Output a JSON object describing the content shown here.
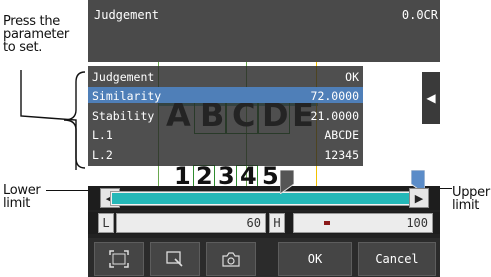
{
  "annotations": {
    "press_line1": "Press the",
    "press_line2": "parameter",
    "press_line3": "to set.",
    "lower_line1": "Lower",
    "lower_line2": "limit",
    "upper_line1": "Upper",
    "upper_line2": "limit"
  },
  "header": {
    "title": "Judgement",
    "value": "0.0CR"
  },
  "params": [
    {
      "key": "Judgement",
      "value": "OK"
    },
    {
      "key": "Similarity",
      "value": "72.0000"
    },
    {
      "key": "Stability",
      "value": "21.0000"
    },
    {
      "key": "L.1",
      "value": "ABCDE"
    },
    {
      "key": "L.2",
      "value": "12345"
    }
  ],
  "view": {
    "letters": [
      "A",
      "B",
      "C",
      "D",
      "E"
    ],
    "digits": [
      "1",
      "2",
      "3",
      "4",
      "5"
    ]
  },
  "slider": {
    "lower": 60,
    "upper": 100,
    "range_max": 100
  },
  "limits": {
    "l_label": "L",
    "h_label": "H",
    "l_value": "60",
    "h_value": "100"
  },
  "bottom": {
    "ok_label": "OK",
    "cancel_label": "Cancel"
  },
  "icons": {
    "frame": "frame-icon",
    "zoom": "zoom-icon",
    "camera": "camera-icon",
    "collapse": "triangle-left-icon"
  },
  "colors": {
    "accent": "#24b8b8",
    "selected": "#4f7fb8"
  }
}
